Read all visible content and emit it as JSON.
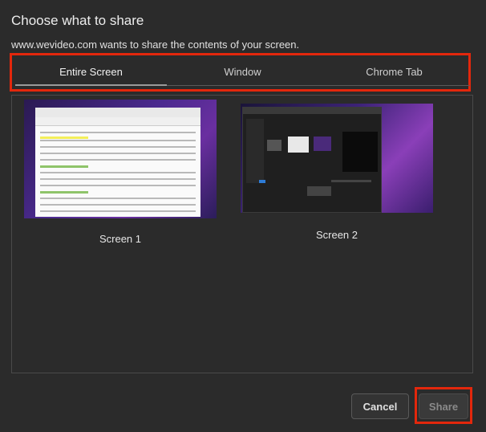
{
  "dialog": {
    "title": "Choose what to share",
    "subtitle": "www.wevideo.com wants to share the contents of your screen."
  },
  "tabs": [
    {
      "label": "Entire Screen",
      "active": true
    },
    {
      "label": "Window",
      "active": false
    },
    {
      "label": "Chrome Tab",
      "active": false
    }
  ],
  "screens": [
    {
      "label": "Screen 1"
    },
    {
      "label": "Screen 2"
    }
  ],
  "buttons": {
    "cancel_label": "Cancel",
    "share_label": "Share",
    "share_enabled": false
  },
  "colors": {
    "highlight": "#e3270c",
    "background": "#2b2b2b"
  }
}
